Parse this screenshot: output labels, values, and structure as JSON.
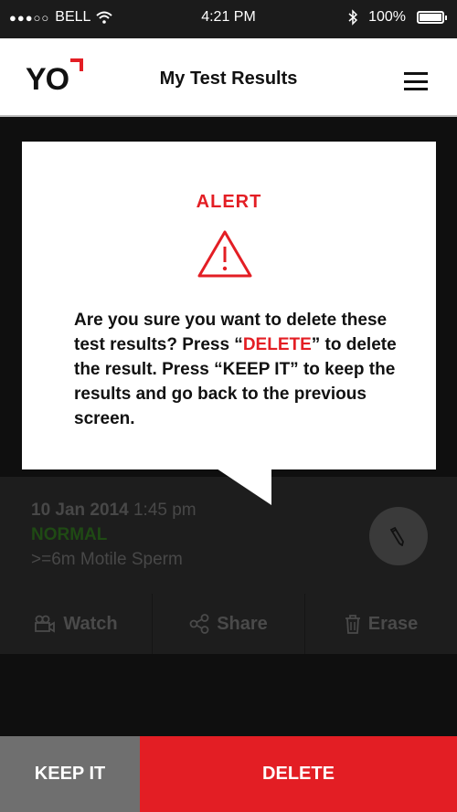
{
  "status_bar": {
    "carrier": "BELL",
    "signal_dots": "●●●○○",
    "time": "4:21 PM",
    "battery_percent": "100%",
    "battery_level": 1.0
  },
  "nav": {
    "logo": "YO",
    "title": "My Test Results"
  },
  "alert": {
    "title": "ALERT",
    "message": {
      "part1": "Are you sure you want to delete these test results? Press “",
      "delete_word": "DELETE",
      "part2": "” to delete the result. Press “KEEP IT” to keep the results and go back to the previous screen."
    }
  },
  "result": {
    "date": "10 Jan 2014",
    "time": "1:45 pm",
    "status": "NORMAL",
    "detail": ">=6m Motile Sperm"
  },
  "actions": {
    "watch": "Watch",
    "share": "Share",
    "erase": "Erase"
  },
  "buttons": {
    "keep": "KEEP IT",
    "delete": "DELETE"
  },
  "colors": {
    "accent_red": "#e31e24",
    "keep_gray": "#6f6f6f"
  }
}
